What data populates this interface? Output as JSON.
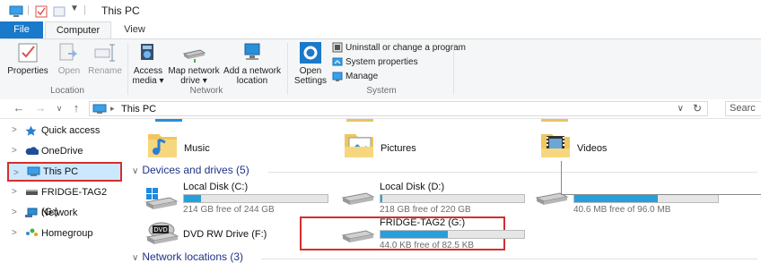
{
  "window": {
    "title": "This PC"
  },
  "ribbon": {
    "tabs": [
      "File",
      "Computer",
      "View"
    ],
    "location": {
      "label": "Location",
      "buttons": [
        {
          "label": "Properties"
        },
        {
          "label": "Open"
        },
        {
          "label": "Rename"
        }
      ]
    },
    "network": {
      "label": "Network",
      "buttons": [
        {
          "line1": "Access",
          "line2": "media ▾"
        },
        {
          "line1": "Map network",
          "line2": "drive ▾"
        },
        {
          "line1": "Add a network",
          "line2": "location"
        }
      ]
    },
    "system": {
      "label": "System",
      "open_settings": {
        "line1": "Open",
        "line2": "Settings"
      },
      "items": [
        "Uninstall or change a program",
        "System properties",
        "Manage"
      ]
    }
  },
  "address": {
    "path": "This PC",
    "search_placeholder": "Searc"
  },
  "nav": {
    "items": [
      {
        "label": "Quick access",
        "icon": "star-icon"
      },
      {
        "label": "OneDrive",
        "icon": "cloud-icon"
      },
      {
        "label": "This PC",
        "icon": "computer-icon",
        "selected": true
      },
      {
        "label": "FRIDGE-TAG2 (G:)",
        "icon": "usb-drive-icon"
      },
      {
        "label": "Network",
        "icon": "network-icon"
      },
      {
        "label": "Homegroup",
        "icon": "homegroup-icon"
      }
    ]
  },
  "folders": [
    {
      "label": "Music",
      "icon": "music-folder-icon"
    },
    {
      "label": "Pictures",
      "icon": "pictures-folder-icon"
    },
    {
      "label": "Videos",
      "icon": "videos-folder-icon"
    }
  ],
  "devices_header": "Devices and drives (5)",
  "drives": [
    {
      "name": "Local Disk (C:)",
      "free": "214 GB free of 244 GB",
      "used_fraction": 0.12,
      "icon": "windows-drive-icon"
    },
    {
      "name": "Local Disk (D:)",
      "free": "218 GB free of 220 GB",
      "used_fraction": 0.01,
      "icon": "hard-drive-icon"
    },
    {
      "name": "",
      "free": "40.6 MB free of 96.0 MB",
      "used_fraction": 0.58,
      "icon": "hard-drive-icon"
    },
    {
      "name": "DVD RW Drive (F:)",
      "free": "",
      "icon": "dvd-drive-icon"
    },
    {
      "name": "FRIDGE-TAG2 (G:)",
      "free": "44.0 KB free of 82.5 KB",
      "used_fraction": 0.47,
      "icon": "usb-drive-icon"
    }
  ],
  "network_header": "Network locations (3)",
  "colors": {
    "accent": "#1979ca",
    "bar_fill": "#26a0da",
    "selection": "#cce8ff",
    "highlight_box": "#d32f2f"
  }
}
